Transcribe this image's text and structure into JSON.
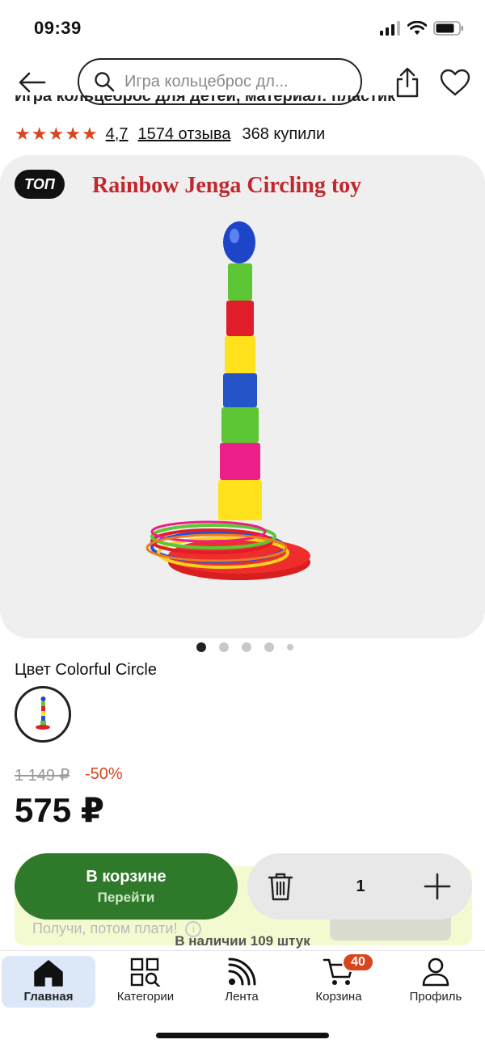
{
  "status_bar": {
    "time": "09:39"
  },
  "header": {
    "search_placeholder": "Игра кольцеброс дл...",
    "icons": [
      "back-arrow-icon",
      "search-icon",
      "share-icon",
      "heart-icon"
    ]
  },
  "product": {
    "title": "Игра кольцеброс для детей, материал: пластик",
    "rating": "4,7",
    "reviews": "1574 отзыва",
    "bought": "368 купили",
    "stars": 5,
    "badge": "ТОП",
    "image_caption": "Rainbow Jenga Circling toy",
    "gallery_dots": 5,
    "gallery_active_index": 0,
    "color_label": "Цвет Colorful Circle",
    "old_price": "1 149 ₽",
    "discount": "-50%",
    "price": "575 ₽"
  },
  "buy_bar": {
    "cart_button_title": "В корзине",
    "cart_button_subtitle": "Перейти",
    "quantity": "1",
    "promo_text": "Получи, потом плати!",
    "stock": "В наличии 109 штук"
  },
  "tabbar": {
    "tabs": [
      {
        "label": "Главная",
        "icon": "home-icon",
        "active": true
      },
      {
        "label": "Категории",
        "icon": "categories-icon",
        "active": false
      },
      {
        "label": "Лента",
        "icon": "feed-icon",
        "active": false
      },
      {
        "label": "Корзина",
        "icon": "cart-icon",
        "active": false,
        "badge": "40"
      },
      {
        "label": "Профиль",
        "icon": "profile-icon",
        "active": false
      }
    ]
  },
  "colors": {
    "accent_green": "#2f7a2a",
    "accent_red": "#d9451f",
    "active_tab_bg": "#dce8f8"
  }
}
